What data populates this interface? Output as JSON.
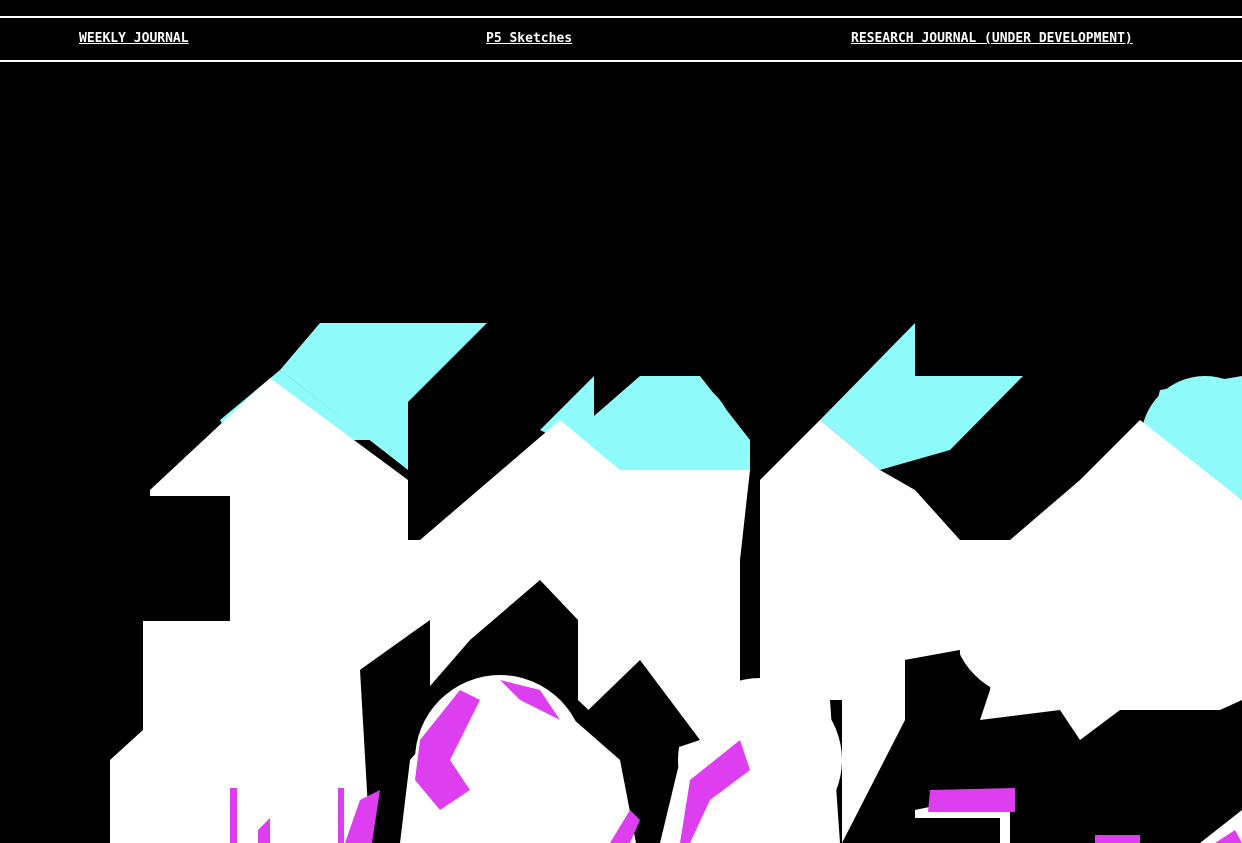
{
  "nav": {
    "items": [
      {
        "label": "WEEKLY JOURNAL"
      },
      {
        "label": "P5 Sketches"
      },
      {
        "label": "RESEARCH JOURNAL (UNDER DEVELOPMENT)"
      }
    ]
  },
  "hero": {
    "artwork": "extruded-glitch-lettering",
    "colors": {
      "background": "#000000",
      "face": "#ffffff",
      "shadow_top": "#8ffafa",
      "accent": "#dd3ff0"
    }
  }
}
